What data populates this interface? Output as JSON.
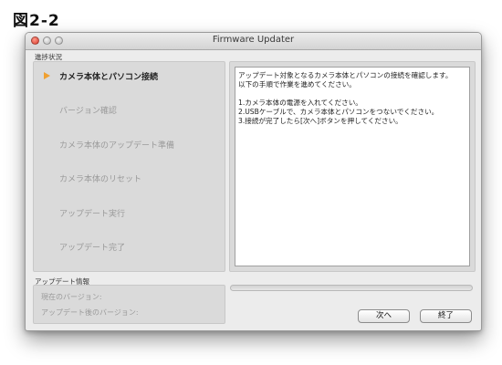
{
  "figure_label": "図2-2",
  "window": {
    "title": "Firmware Updater"
  },
  "progress_section": {
    "label": "進捗状況",
    "steps": [
      {
        "label": "カメラ本体とパソコン接続",
        "active": true
      },
      {
        "label": "バージョン確認",
        "active": false
      },
      {
        "label": "カメラ本体のアップデート準備",
        "active": false
      },
      {
        "label": "カメラ本体のリセット",
        "active": false
      },
      {
        "label": "アップデート実行",
        "active": false
      },
      {
        "label": "アップデート完了",
        "active": false
      }
    ]
  },
  "detail": {
    "lines": [
      "アップデート対象となるカメラ本体とパソコンの接続を確認します。",
      "以下の手順で作業を進めてください。",
      "",
      "1.カメラ本体の電源を入れてください。",
      "2.USBケーブルで、カメラ本体とパソコンをつないでください。",
      "3.接続が完了したら[次へ]ボタンを押してください。"
    ]
  },
  "update_info": {
    "label": "アップデート情報",
    "current_version_label": "現在のバージョン:",
    "after_version_label": "アップデート後のバージョン:"
  },
  "progress_bar": {
    "fraction": 0
  },
  "buttons": {
    "next_label": "次へ",
    "finish_label": "終了"
  },
  "colors": {
    "active_step_arrow": "#f0a030",
    "inactive_text": "#9a9a9a"
  }
}
